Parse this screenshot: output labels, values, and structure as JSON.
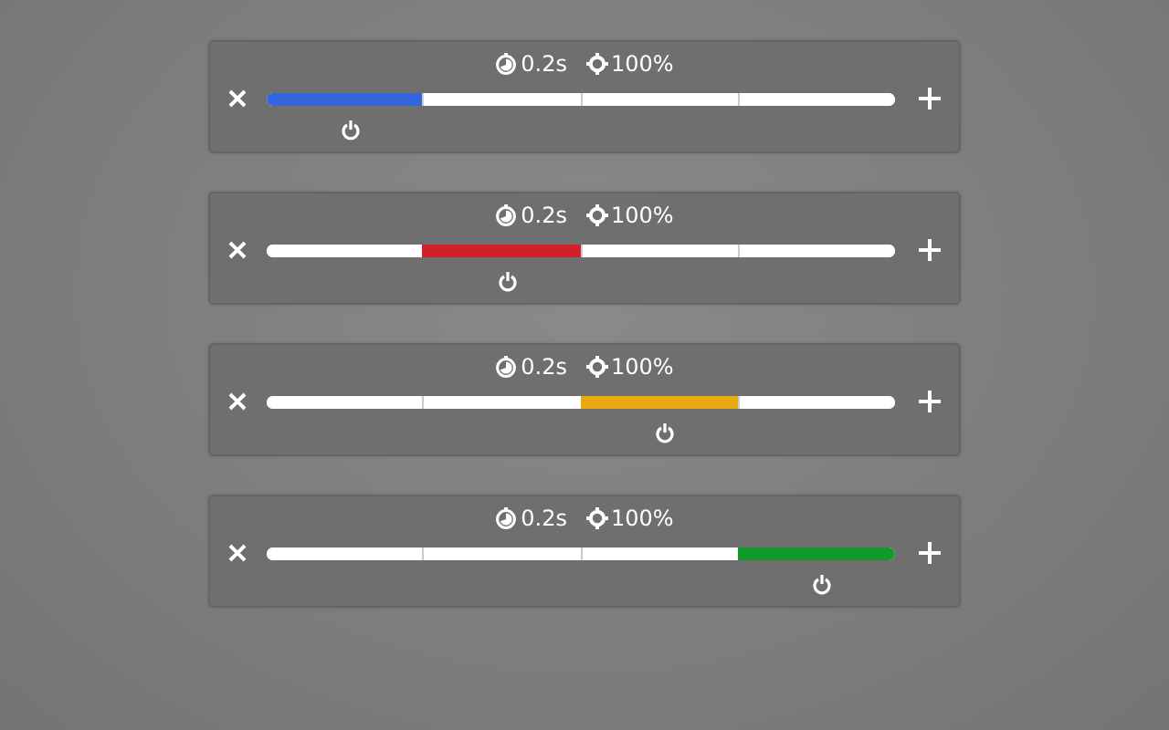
{
  "panels": [
    {
      "delay": "0.2s",
      "brightness": "100%",
      "color": "#3366dd",
      "segments": [
        {
          "selected": true
        },
        {
          "selected": false
        },
        {
          "selected": false
        },
        {
          "selected": false
        }
      ]
    },
    {
      "delay": "0.2s",
      "brightness": "100%",
      "color": "#d0202a",
      "segments": [
        {
          "selected": false
        },
        {
          "selected": true
        },
        {
          "selected": false
        },
        {
          "selected": false
        }
      ]
    },
    {
      "delay": "0.2s",
      "brightness": "100%",
      "color": "#e8aa10",
      "segments": [
        {
          "selected": false
        },
        {
          "selected": false
        },
        {
          "selected": true
        },
        {
          "selected": false
        }
      ]
    },
    {
      "delay": "0.2s",
      "brightness": "100%",
      "color": "#12992a",
      "segments": [
        {
          "selected": false
        },
        {
          "selected": false
        },
        {
          "selected": false
        },
        {
          "selected": true
        }
      ]
    }
  ]
}
